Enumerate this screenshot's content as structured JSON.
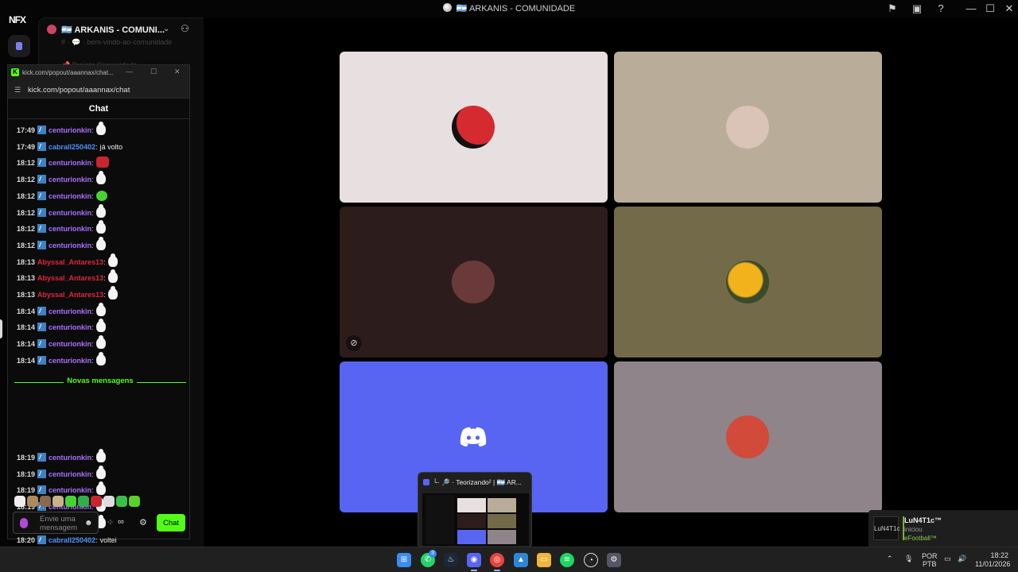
{
  "window": {
    "title": "🇦🇷 ARKANIS - COMUNIDADE",
    "inbox_icon": "inbox-icon",
    "help_icon": "help-icon",
    "min": "—",
    "max": "☐",
    "close": "✕"
  },
  "rail": {
    "logo": "NFX"
  },
  "sidebar": {
    "server_name": "🇦🇷 ARKANIS - COMUNI...",
    "faded_1": "# · 💬 · bem-vindo-ao-comunidade",
    "faded_2": "📌 Projeto Comunidade"
  },
  "popout": {
    "window_title": "kick.com/popout/aaannax/chat...",
    "url": "kick.com/popout/aaannax/chat",
    "header": "Chat",
    "new_messages_label": "Novas mensagens",
    "input_placeholder": "Envie uma mensagem",
    "infinity": "∞",
    "send_button": "Chat"
  },
  "chat_messages": [
    {
      "time": "17:49",
      "user": "centurionkin",
      "color": "#a970ff",
      "emote": "ghost"
    },
    {
      "time": "17:49",
      "user": "cabrall250402",
      "color": "#4f8ff7",
      "text": "já volto"
    },
    {
      "time": "18:12",
      "user": "centurionkin",
      "color": "#a970ff",
      "emote": "red"
    },
    {
      "time": "18:12",
      "user": "centurionkin",
      "color": "#a970ff",
      "emote": "ghost"
    },
    {
      "time": "18:12",
      "user": "centurionkin",
      "color": "#a970ff",
      "emote": "green"
    },
    {
      "time": "18:12",
      "user": "centurionkin",
      "color": "#a970ff",
      "emote": "ghost"
    },
    {
      "time": "18:12",
      "user": "centurionkin",
      "color": "#a970ff",
      "emote": "ghost"
    },
    {
      "time": "18:12",
      "user": "centurionkin",
      "color": "#a970ff",
      "emote": "ghost"
    },
    {
      "time": "18:13",
      "user": "Abyssal_Antares13",
      "color": "#e0263f",
      "emote": "ghost"
    },
    {
      "time": "18:13",
      "user": "Abyssal_Antares13",
      "color": "#e0263f",
      "emote": "ghost"
    },
    {
      "time": "18:13",
      "user": "Abyssal_Antares13",
      "color": "#e0263f",
      "emote": "ghost"
    },
    {
      "time": "18:14",
      "user": "centurionkin",
      "color": "#a970ff",
      "emote": "ghost"
    },
    {
      "time": "18:14",
      "user": "centurionkin",
      "color": "#a970ff",
      "emote": "ghost"
    },
    {
      "time": "18:14",
      "user": "centurionkin",
      "color": "#a970ff",
      "emote": "ghost"
    },
    {
      "time": "18:14",
      "user": "centurionkin",
      "color": "#a970ff",
      "emote": "ghost"
    },
    {
      "time": "18:19",
      "user": "centurionkin",
      "color": "#a970ff",
      "emote": "ghost"
    },
    {
      "time": "18:19",
      "user": "centurionkin",
      "color": "#a970ff",
      "emote": "ghost"
    },
    {
      "time": "18:19",
      "user": "centurionkin",
      "color": "#a970ff",
      "emote": "ghost"
    },
    {
      "time": "18:19",
      "user": "centurionkin",
      "color": "#a970ff",
      "emote": "ghost"
    },
    {
      "time": "18:19",
      "user": "centurionkin",
      "color": "#a970ff",
      "emote": "ghost"
    },
    {
      "time": "18:20",
      "user": "cabrall250402",
      "color": "#4f8ff7",
      "text": "voltei"
    }
  ],
  "video_tiles": [
    {
      "bg": "#e8e0e0",
      "avatar": "#c0262c",
      "muted": false
    },
    {
      "bg": "#b9ad9a",
      "avatar": "#d9c4b7",
      "muted": false
    },
    {
      "bg": "#2d1c1c",
      "avatar": "#6a3a3a",
      "muted": true
    },
    {
      "bg": "#736a4a",
      "avatar": "#e8a81e",
      "muted": false
    },
    {
      "bg": "#5865f2",
      "avatar": "discord",
      "muted": false
    },
    {
      "bg": "#8e8489",
      "avatar": "#d24a3a",
      "muted": false
    }
  ],
  "preview": {
    "title": "└· 🔎 · Teorizando² | 🇦🇷 AR..."
  },
  "notification": {
    "pic_label": "LuN4T1c",
    "name": "LuN4T1c™",
    "status": "iniciou",
    "game": "eFootball™"
  },
  "taskbar": {
    "lang_1": "POR",
    "lang_2": "PTB",
    "time": "18:22",
    "date": "11/01/2026",
    "whatsapp_badge": "3"
  },
  "colors": {
    "kick_green": "#53fc18",
    "discord_blurple": "#5865f2"
  }
}
